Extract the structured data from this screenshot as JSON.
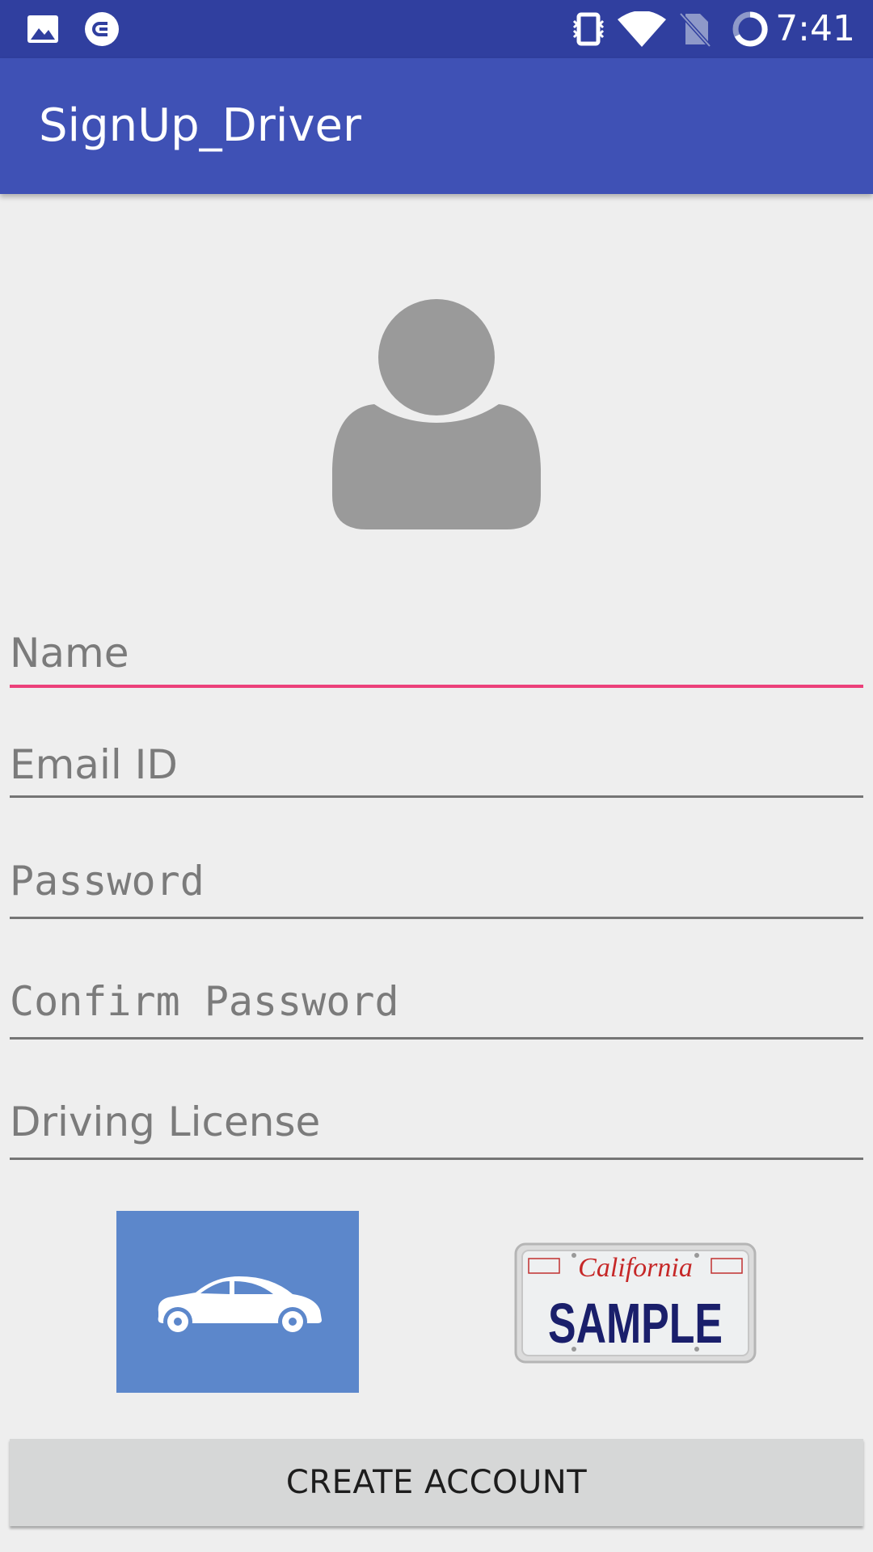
{
  "status_bar": {
    "time": "7:41",
    "icons": [
      "image-icon",
      "cast-badge-icon",
      "vibrate-icon",
      "wifi-icon",
      "no-sim-icon",
      "battery-charging-icon"
    ]
  },
  "app_bar": {
    "title": "SignUp_Driver"
  },
  "avatar": {
    "icon": "user-avatar-icon"
  },
  "form": {
    "name_placeholder": "Name",
    "email_placeholder": "Email ID",
    "password_placeholder": "Password",
    "confirm_password_placeholder": "Confirm Password",
    "license_placeholder": "Driving License"
  },
  "vehicle_images": {
    "car_icon": "car-icon",
    "plate": {
      "state": "California",
      "number": "SAMPLE"
    }
  },
  "actions": {
    "create_account_label": "CREATE ACCOUNT"
  },
  "colors": {
    "status_bar": "#303f9f",
    "app_bar": "#3f51b5",
    "accent": "#ec407a",
    "car_tile": "#5c87cb"
  }
}
